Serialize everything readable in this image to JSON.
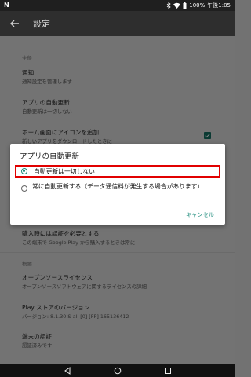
{
  "status_bar": {
    "carrier_icon": "N",
    "battery": "100%",
    "time": "午後1:05"
  },
  "toolbar": {
    "title": "設定"
  },
  "settings": {
    "section_general": "全般",
    "notify_title": "通知",
    "notify_sub": "通知設定を管理します",
    "autoupdate_title": "アプリの自動更新",
    "autoupdate_sub": "自動更新は一切しない",
    "homescreen_title": "ホーム画面にアイコンを追加",
    "homescreen_sub": "新しいアプリをダウンロードしたときに",
    "purchase_title": "購入時には認証を必要とする",
    "purchase_sub": "この端末で Google Play から購入するときは常に",
    "section_about": "概要",
    "oss_title": "オープンソースライセンス",
    "oss_sub": "オープンソースソフトウェアに関するライセンスの詳細",
    "version_title": "Play ストアのバージョン",
    "version_sub": "バージョン: 8.1.30.S-all [0] [FP] 165136412",
    "cert_title": "端末の認証",
    "cert_sub": "認証済みです"
  },
  "dialog": {
    "title": "アプリの自動更新",
    "option_never": "自動更新は一切しない",
    "option_always": "常に自動更新する（データ通信料が発生する場合があります）",
    "cancel": "キャンセル",
    "selected": "option_never"
  },
  "colors": {
    "accent": "#1a8a7a",
    "highlight": "#e10000"
  }
}
